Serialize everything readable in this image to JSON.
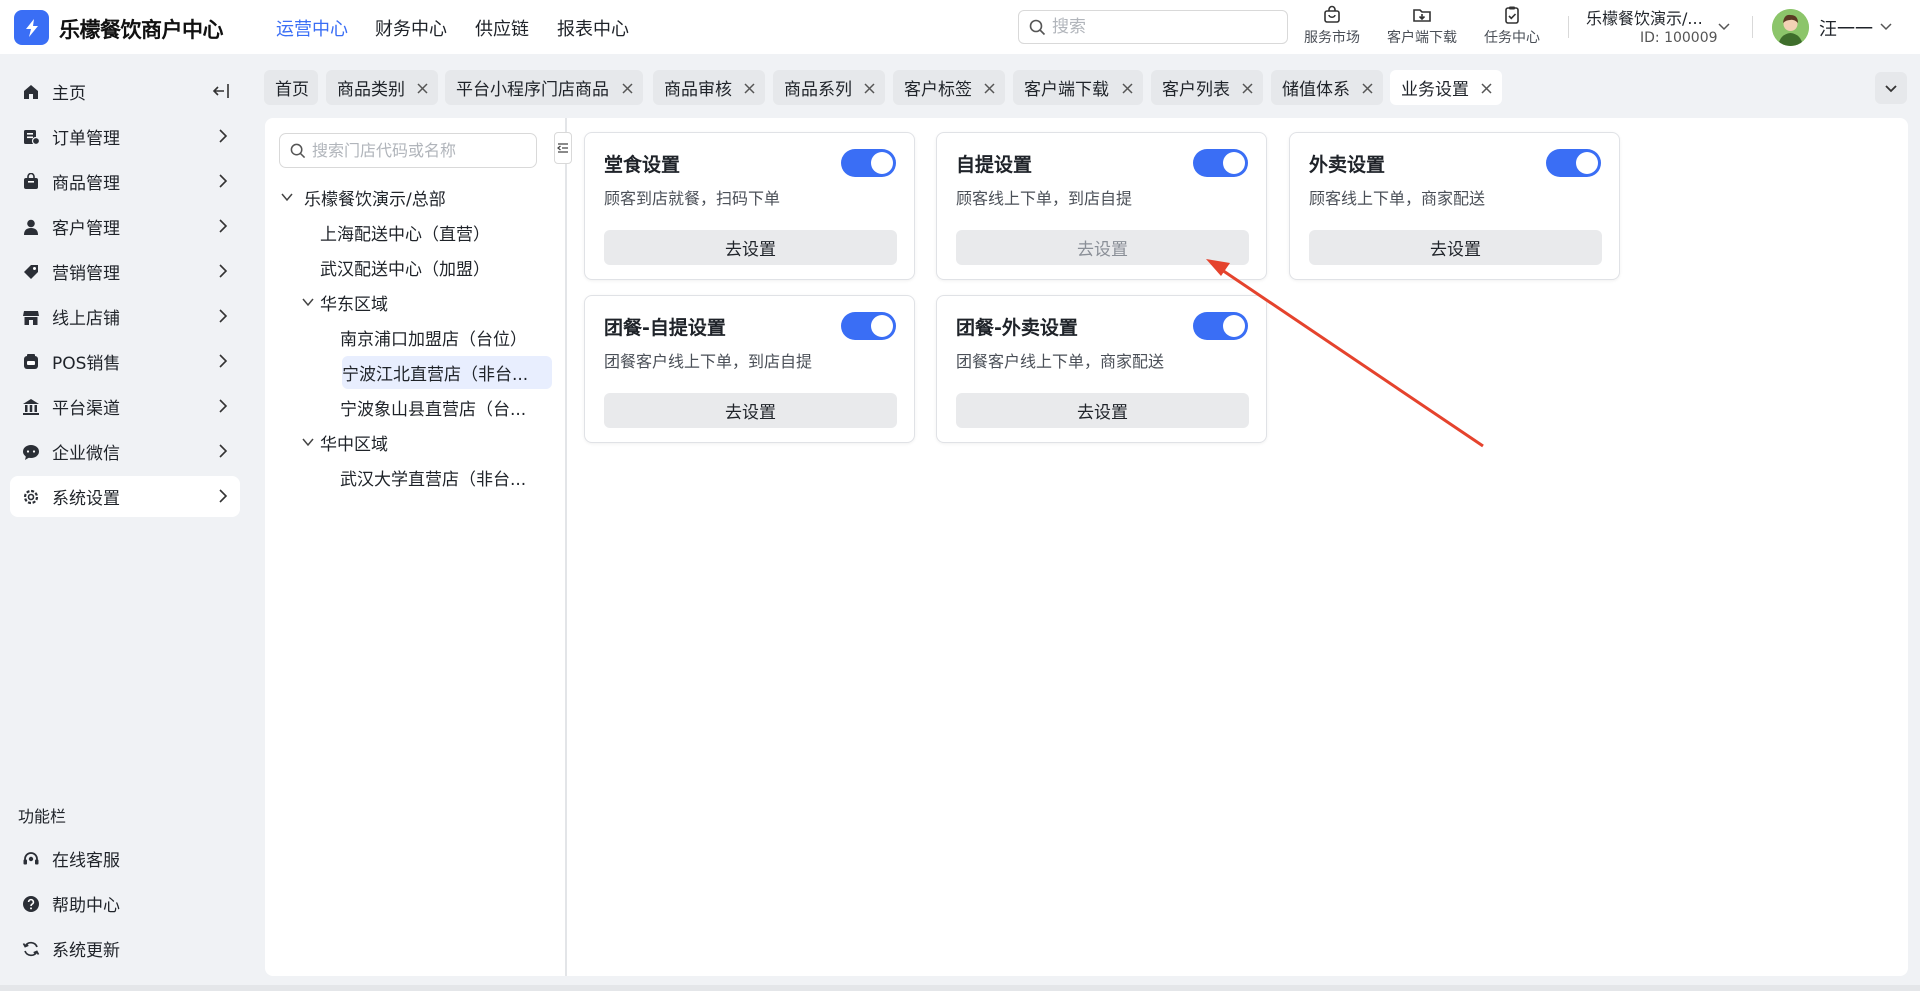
{
  "app": {
    "title": "乐檬餐饮商户中心"
  },
  "topnav": [
    {
      "label": "运营中心",
      "active": true
    },
    {
      "label": "财务中心",
      "active": false
    },
    {
      "label": "供应链",
      "active": false
    },
    {
      "label": "报表中心",
      "active": false
    }
  ],
  "search": {
    "placeholder": "搜索"
  },
  "tools": [
    {
      "label": "服务市场",
      "icon": "shopping-bag-icon"
    },
    {
      "label": "客户端下载",
      "icon": "folder-download-icon"
    },
    {
      "label": "任务中心",
      "icon": "clipboard-check-icon"
    }
  ],
  "org": {
    "name": "乐檬餐饮演示/...",
    "id": "ID: 100009"
  },
  "user": {
    "name": "汪一一"
  },
  "sidebar": {
    "items": [
      {
        "label": "主页",
        "icon": "home-icon"
      },
      {
        "label": "订单管理",
        "icon": "order-icon"
      },
      {
        "label": "商品管理",
        "icon": "product-icon"
      },
      {
        "label": "客户管理",
        "icon": "customer-icon"
      },
      {
        "label": "营销管理",
        "icon": "tag-icon"
      },
      {
        "label": "线上店铺",
        "icon": "store-icon"
      },
      {
        "label": "POS销售",
        "icon": "pos-icon"
      },
      {
        "label": "平台渠道",
        "icon": "bank-icon"
      },
      {
        "label": "企业微信",
        "icon": "chat-icon"
      },
      {
        "label": "系统设置",
        "icon": "gear-icon",
        "active": true
      }
    ],
    "section_title": "功能栏",
    "footer_items": [
      {
        "label": "在线客服",
        "icon": "headset-icon"
      },
      {
        "label": "帮助中心",
        "icon": "help-icon"
      },
      {
        "label": "系统更新",
        "icon": "refresh-icon"
      }
    ]
  },
  "tabs": [
    {
      "label": "首页",
      "closable": false
    },
    {
      "label": "商品类别",
      "closable": true
    },
    {
      "label": "平台小程序门店商品",
      "closable": true
    },
    {
      "label": "商品审核",
      "closable": true
    },
    {
      "label": "商品系列",
      "closable": true
    },
    {
      "label": "客户标签",
      "closable": true
    },
    {
      "label": "客户端下载",
      "closable": true
    },
    {
      "label": "客户列表",
      "closable": true
    },
    {
      "label": "储值体系",
      "closable": true
    },
    {
      "label": "业务设置",
      "closable": true,
      "active": true
    }
  ],
  "tree": {
    "search_placeholder": "搜索门店代码或名称",
    "nodes": [
      {
        "label": "乐檬餐饮演示/总部",
        "expanded": true
      },
      {
        "label": "上海配送中心（直营）"
      },
      {
        "label": "武汉配送中心（加盟）"
      },
      {
        "label": "华东区域",
        "expanded": true
      },
      {
        "label": "南京浦口加盟店（台位）"
      },
      {
        "label": "宁波江北直营店（非台...",
        "selected": true
      },
      {
        "label": "宁波象山县直营店（台..."
      },
      {
        "label": "华中区域",
        "expanded": true
      },
      {
        "label": "武汉大学直营店（非台..."
      }
    ]
  },
  "cards": [
    {
      "title": "堂食设置",
      "desc": "顾客到店就餐，扫码下单",
      "enabled": true,
      "button": "去设置"
    },
    {
      "title": "自提设置",
      "desc": "顾客线上下单，到店自提",
      "enabled": true,
      "button": "去设置",
      "button_muted": true
    },
    {
      "title": "外卖设置",
      "desc": "顾客线上下单，商家配送",
      "enabled": true,
      "button": "去设置"
    },
    {
      "title": "团餐-自提设置",
      "desc": "团餐客户线上下单，到店自提",
      "enabled": true,
      "button": "去设置"
    },
    {
      "title": "团餐-外卖设置",
      "desc": "团餐客户线上下单，商家配送",
      "enabled": true,
      "button": "去设置"
    }
  ],
  "colors": {
    "accent": "#3a6ef5",
    "annotation_arrow": "#e5432d",
    "selected_bg": "#e8eefe"
  }
}
